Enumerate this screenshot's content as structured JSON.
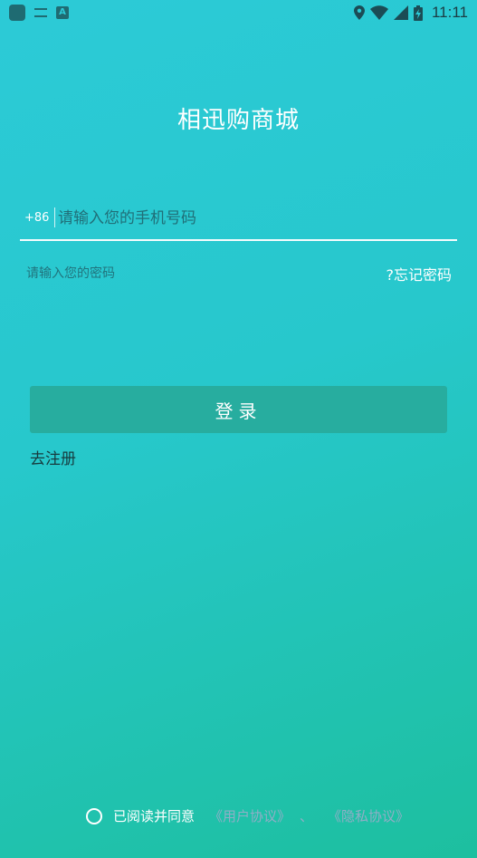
{
  "status_bar": {
    "time": "11:11",
    "icons": [
      "app-icon",
      "notification-icon",
      "a-icon",
      "location-icon",
      "wifi-icon",
      "signal-icon",
      "battery-icon"
    ]
  },
  "title": "相迅购商城",
  "phone": {
    "country_code": "+86",
    "placeholder": "请输入您的手机号码"
  },
  "password": {
    "placeholder": "请输入您的密码",
    "forgot_label": "?忘记密码"
  },
  "login_label": "登录",
  "register_label": "去注册",
  "agreement": {
    "text": "已阅读并同意",
    "user_agreement": "《用户协议》",
    "separator": "、",
    "privacy_policy": "《隐私协议》"
  },
  "colors": {
    "gradient_start": "#2ccad7",
    "gradient_end": "#1dbf9f",
    "button": "#27ad9f"
  }
}
